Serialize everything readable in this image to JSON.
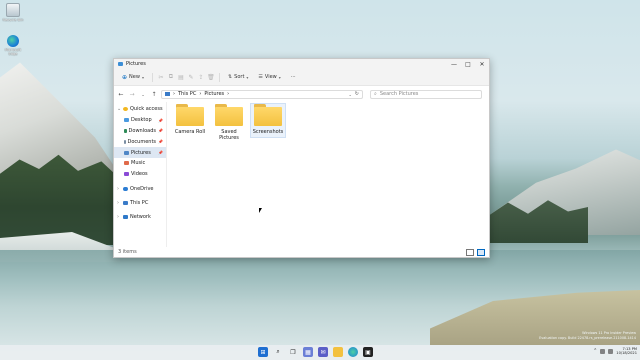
{
  "desktop": {
    "icons": [
      {
        "label": "Recycle Bin",
        "icon": "recycle-bin-icon"
      },
      {
        "label": "Microsoft Edge",
        "icon": "edge-icon"
      }
    ]
  },
  "window": {
    "title": "Pictures",
    "controls": {
      "minimize": "—",
      "maximize": "□",
      "close": "✕"
    },
    "commandbar": {
      "new_label": "New",
      "sort_label": "Sort",
      "view_label": "View",
      "more": "···"
    },
    "address": {
      "crumbs": [
        "This PC",
        "Pictures"
      ],
      "separator": "›"
    },
    "search": {
      "placeholder": "Search Pictures"
    },
    "sidebar": {
      "quick_access": "Quick access",
      "items": [
        {
          "label": "Desktop",
          "color": "#4a9ae0"
        },
        {
          "label": "Downloads",
          "color": "#2e8b57"
        },
        {
          "label": "Documents",
          "color": "#7a8ea3"
        },
        {
          "label": "Pictures",
          "color": "#4f86c6"
        },
        {
          "label": "Music",
          "color": "#e06a4a"
        },
        {
          "label": "Videos",
          "color": "#8a4ad6"
        }
      ],
      "onedrive": "OneDrive",
      "this_pc": "This PC",
      "network": "Network"
    },
    "folders": [
      {
        "label": "Camera Roll"
      },
      {
        "label": "Saved Pictures"
      },
      {
        "label": "Screenshots"
      }
    ],
    "status": {
      "count": "3 items"
    }
  },
  "watermark": {
    "line1": "Windows 11 Pro Insider Preview",
    "line2": "Evaluation copy. Build 22478.rs_prerelease.211008-1414"
  },
  "taskbar": {
    "time": "7:13 PM",
    "date": "10/18/2021"
  }
}
